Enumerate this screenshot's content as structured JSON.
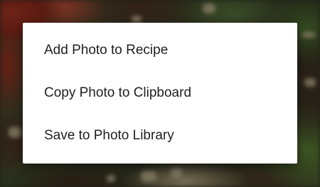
{
  "menu": {
    "items": [
      {
        "label": "Add Photo to Recipe"
      },
      {
        "label": "Copy Photo to Clipboard"
      },
      {
        "label": "Save to Photo Library"
      }
    ]
  },
  "colors": {
    "menu_background": "#ffffff",
    "menu_text": "#1f1f1f",
    "scrim": "rgba(0,0,0,0.45)"
  }
}
